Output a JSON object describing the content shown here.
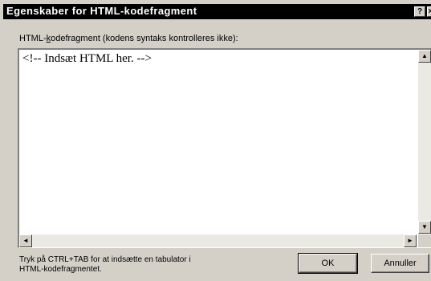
{
  "window": {
    "title": "Egenskaber for HTML-kodefragment",
    "help_glyph": "?",
    "close_glyph": "×"
  },
  "field": {
    "label_pre": "HTML-",
    "label_underlined": "k",
    "label_post": "odefragment (kodens syntaks kontrolleres ikke):",
    "value": "<!-- Indsæt HTML her. -->"
  },
  "scroll": {
    "up": "▲",
    "down": "▼",
    "left": "◄",
    "right": "►"
  },
  "hint": {
    "line1": "Tryk på CTRL+TAB for at indsætte en tabulator i",
    "line2": "HTML-kodefragmentet."
  },
  "buttons": {
    "ok": "OK",
    "cancel": "Annuller"
  }
}
